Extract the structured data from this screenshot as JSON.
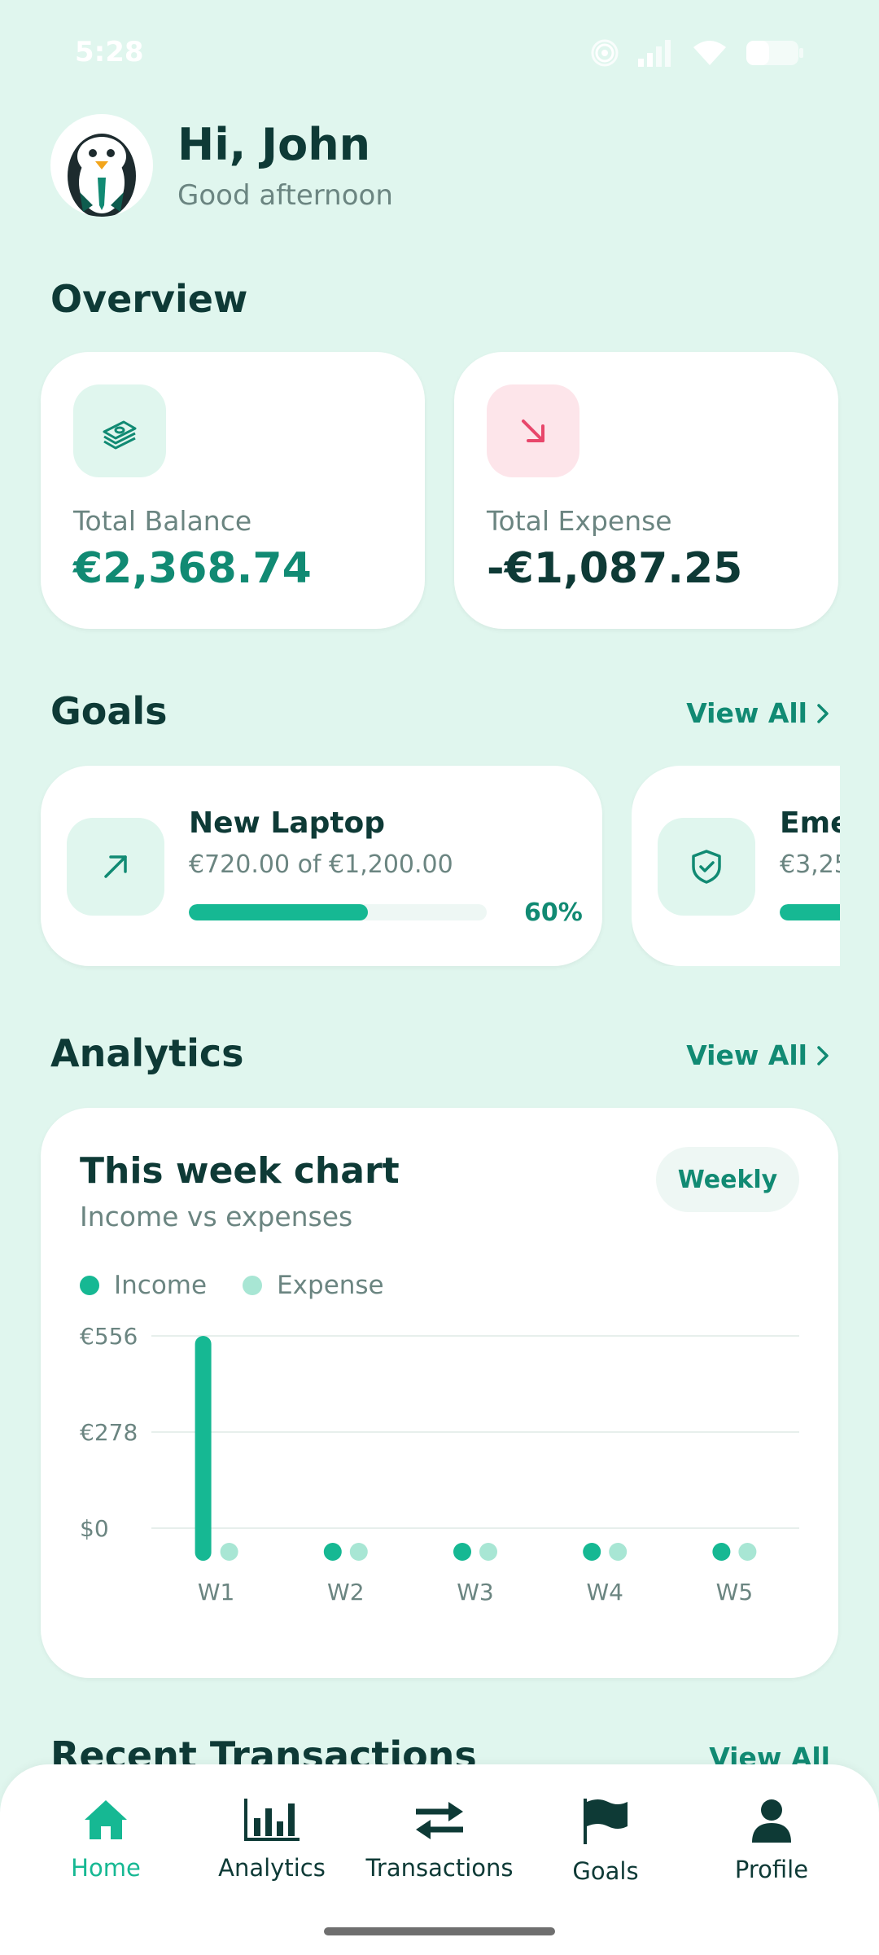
{
  "status_bar": {
    "time": "5:28"
  },
  "header": {
    "greeting": "Hi, John",
    "subtitle": "Good afternoon"
  },
  "overview": {
    "title": "Overview",
    "cards": [
      {
        "label": "Total Balance",
        "value": "€2,368.74",
        "icon": "money-stack-icon",
        "color": "#118a73",
        "tile_color": "#e0f6ee"
      },
      {
        "label": "Total Expense",
        "value": "-€1,087.25",
        "icon": "arrow-down-right-icon",
        "color": "#0e3a36",
        "tile_color": "#fde5ea"
      }
    ]
  },
  "goals": {
    "title": "Goals",
    "view_all": "View All",
    "items": [
      {
        "name": "New Laptop",
        "progress_text": "€720.00 of €1,200.00",
        "percent_label": "60%",
        "progress": 0.6,
        "icon": "arrow-up-right-icon"
      },
      {
        "name": "Eme",
        "progress_text": "€3,25",
        "icon": "shield-check-icon"
      }
    ]
  },
  "analytics": {
    "title": "Analytics",
    "view_all": "View All",
    "card": {
      "title": "This week chart",
      "subtitle": "Income vs expenses",
      "period": "Weekly"
    }
  },
  "chart_data": {
    "type": "bar",
    "categories": [
      "W1",
      "W2",
      "W3",
      "W4",
      "W5"
    ],
    "series": [
      {
        "name": "Income",
        "values": [
          556,
          0,
          0,
          0,
          0
        ],
        "color": "#16b893"
      },
      {
        "name": "Expense",
        "values": [
          0,
          0,
          0,
          0,
          0
        ],
        "color": "#a8e6d4"
      }
    ],
    "ytick_labels": [
      "€556",
      "€278",
      "$0"
    ],
    "ylim": [
      0,
      556
    ],
    "grid": true
  },
  "recent": {
    "title": "Recent Transactions",
    "view_all": "View All"
  },
  "nav": {
    "items": [
      {
        "label": "Home",
        "icon": "home-icon",
        "active": true
      },
      {
        "label": "Analytics",
        "icon": "bar-chart-icon"
      },
      {
        "label": "Transactions",
        "icon": "transfer-arrows-icon"
      },
      {
        "label": "Goals",
        "icon": "flag-icon"
      },
      {
        "label": "Profile",
        "icon": "user-icon"
      }
    ]
  },
  "colors": {
    "accent": "#16b893",
    "background": "#e0f6ee",
    "dark": "#0e3a36",
    "muted": "#6b8581"
  }
}
